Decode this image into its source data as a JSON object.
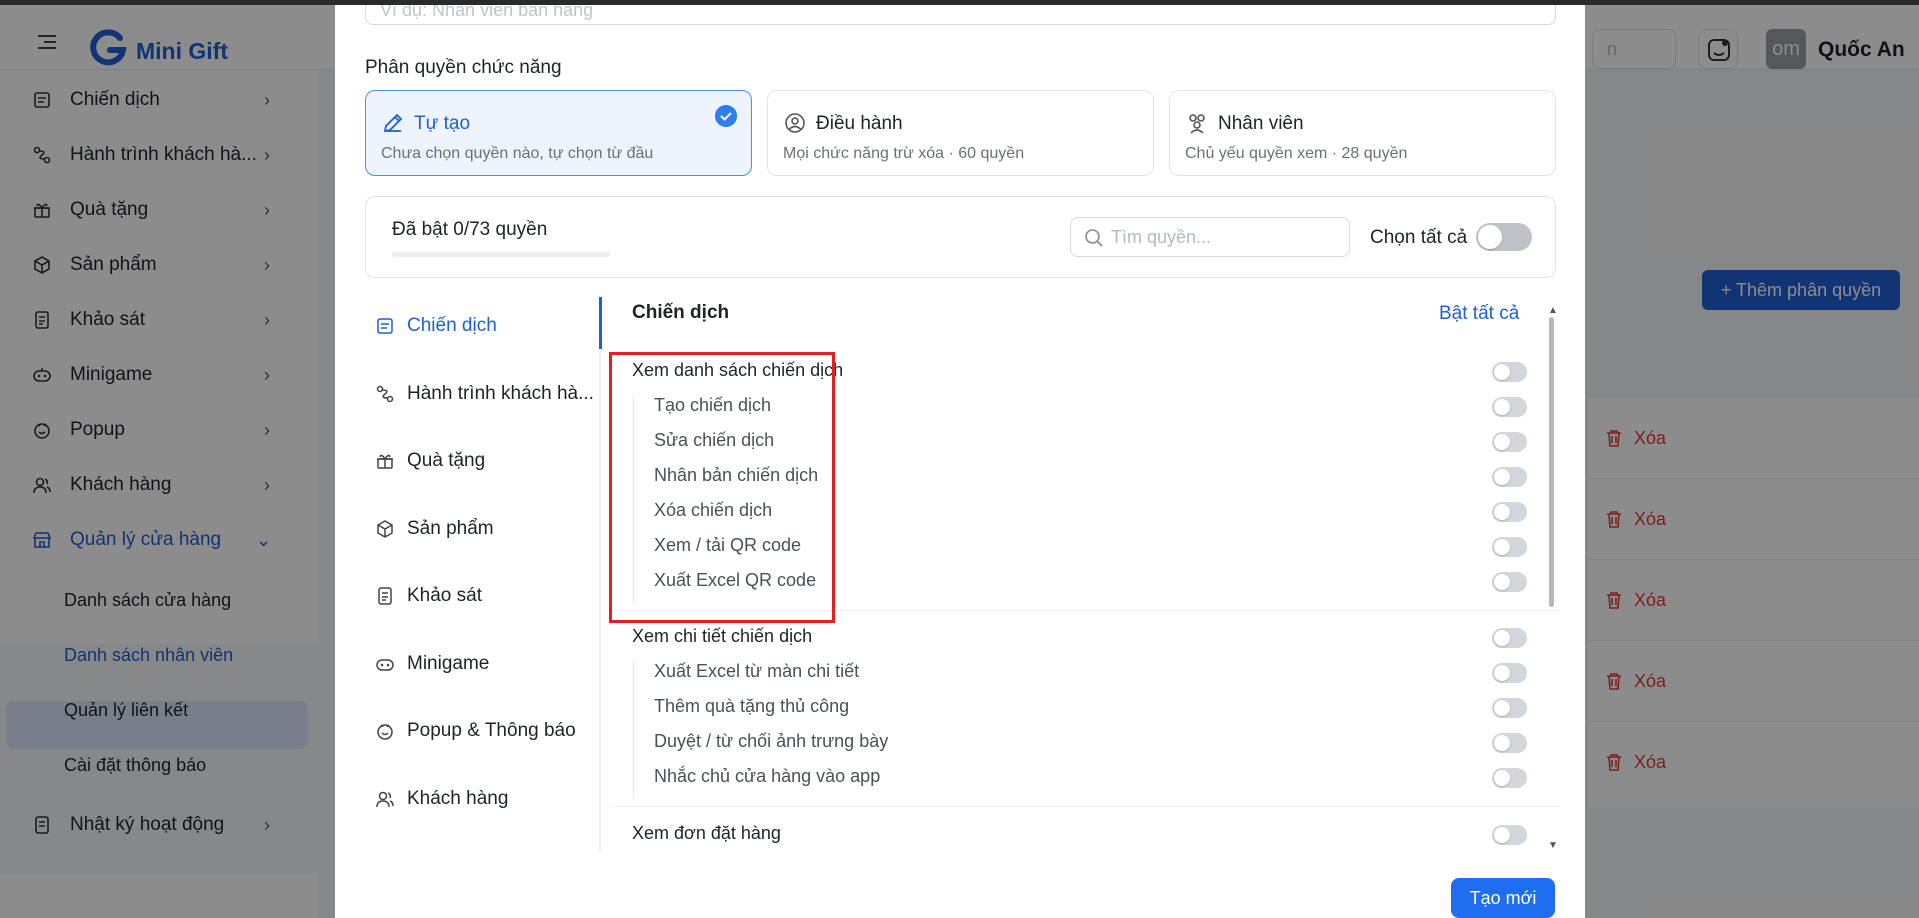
{
  "app": {
    "brand": "Mini Gift",
    "search_placeholder": "n",
    "avatar_text": "om",
    "user_name": "Quốc An"
  },
  "sidebar": {
    "items": [
      {
        "label": "Chiến dịch",
        "icon": "campaign-icon"
      },
      {
        "label": "Hành trình khách hà...",
        "icon": "journey-icon"
      },
      {
        "label": "Quà tặng",
        "icon": "gift-icon"
      },
      {
        "label": "Sản phẩm",
        "icon": "box-icon"
      },
      {
        "label": "Khảo sát",
        "icon": "survey-icon"
      },
      {
        "label": "Minigame",
        "icon": "game-icon"
      },
      {
        "label": "Popup",
        "icon": "popup-icon"
      },
      {
        "label": "Khách hàng",
        "icon": "users-icon"
      },
      {
        "label": "Quản lý cửa hàng",
        "icon": "store-icon"
      },
      {
        "label": "Nhật ký hoạt động",
        "icon": "log-icon"
      }
    ],
    "sub_items": [
      "Danh sách cửa hàng",
      "Danh sách nhân viên",
      "Quản lý liên kết",
      "Cài đặt thông báo"
    ]
  },
  "background": {
    "add_permission_label": "+ Thêm phân quyền",
    "delete_label": "Xóa"
  },
  "modal": {
    "name_placeholder": "Ví dụ: Nhân viên bán hàng",
    "section_label": "Phân quyền chức năng",
    "roles": [
      {
        "title": "Tự tạo",
        "desc": "Chưa chọn quyền nào, tự chọn từ đầu",
        "selected": true
      },
      {
        "title": "Điều hành",
        "desc": "Mọi chức năng trừ xóa · 60 quyền",
        "selected": false
      },
      {
        "title": "Nhân viên",
        "desc": "Chủ yếu quyền xem · 28 quyền",
        "selected": false
      }
    ],
    "enabled_count": "Đã bật 0/73 quyền",
    "enabled_fraction": 0,
    "search_placeholder": "Tìm quyền...",
    "select_all_label": "Chọn tất cả",
    "categories": [
      {
        "label": "Chiến dịch",
        "active": true
      },
      {
        "label": "Hành trình khách hà...",
        "active": false
      },
      {
        "label": "Quà tặng",
        "active": false
      },
      {
        "label": "Sản phẩm",
        "active": false
      },
      {
        "label": "Khảo sát",
        "active": false
      },
      {
        "label": "Minigame",
        "active": false
      },
      {
        "label": "Popup & Thông báo",
        "active": false
      },
      {
        "label": "Khách hàng",
        "active": false
      }
    ],
    "panel_title": "Chiến dịch",
    "enable_all_label": "Bật tất cả",
    "groups": [
      {
        "main": "Xem danh sách chiến dịch",
        "subs": [
          "Tạo chiến dịch",
          "Sửa chiến dịch",
          "Nhân bản chiến dịch",
          "Xóa chiến dịch",
          "Xem / tải QR code",
          "Xuất Excel QR code"
        ]
      },
      {
        "main": "Xem chi tiết chiến dịch",
        "subs": [
          "Xuất Excel từ màn chi tiết",
          "Thêm quà tặng thủ công",
          "Duyệt / từ chối ảnh trưng bày",
          "Nhắc chủ cửa hàng vào app"
        ]
      },
      {
        "main": "Xem đơn đặt hàng",
        "subs": []
      }
    ],
    "create_label": "Tạo mới"
  },
  "colors": {
    "accent": "#1f5fd4",
    "danger": "#e53935",
    "highlight": "#e31e24"
  }
}
